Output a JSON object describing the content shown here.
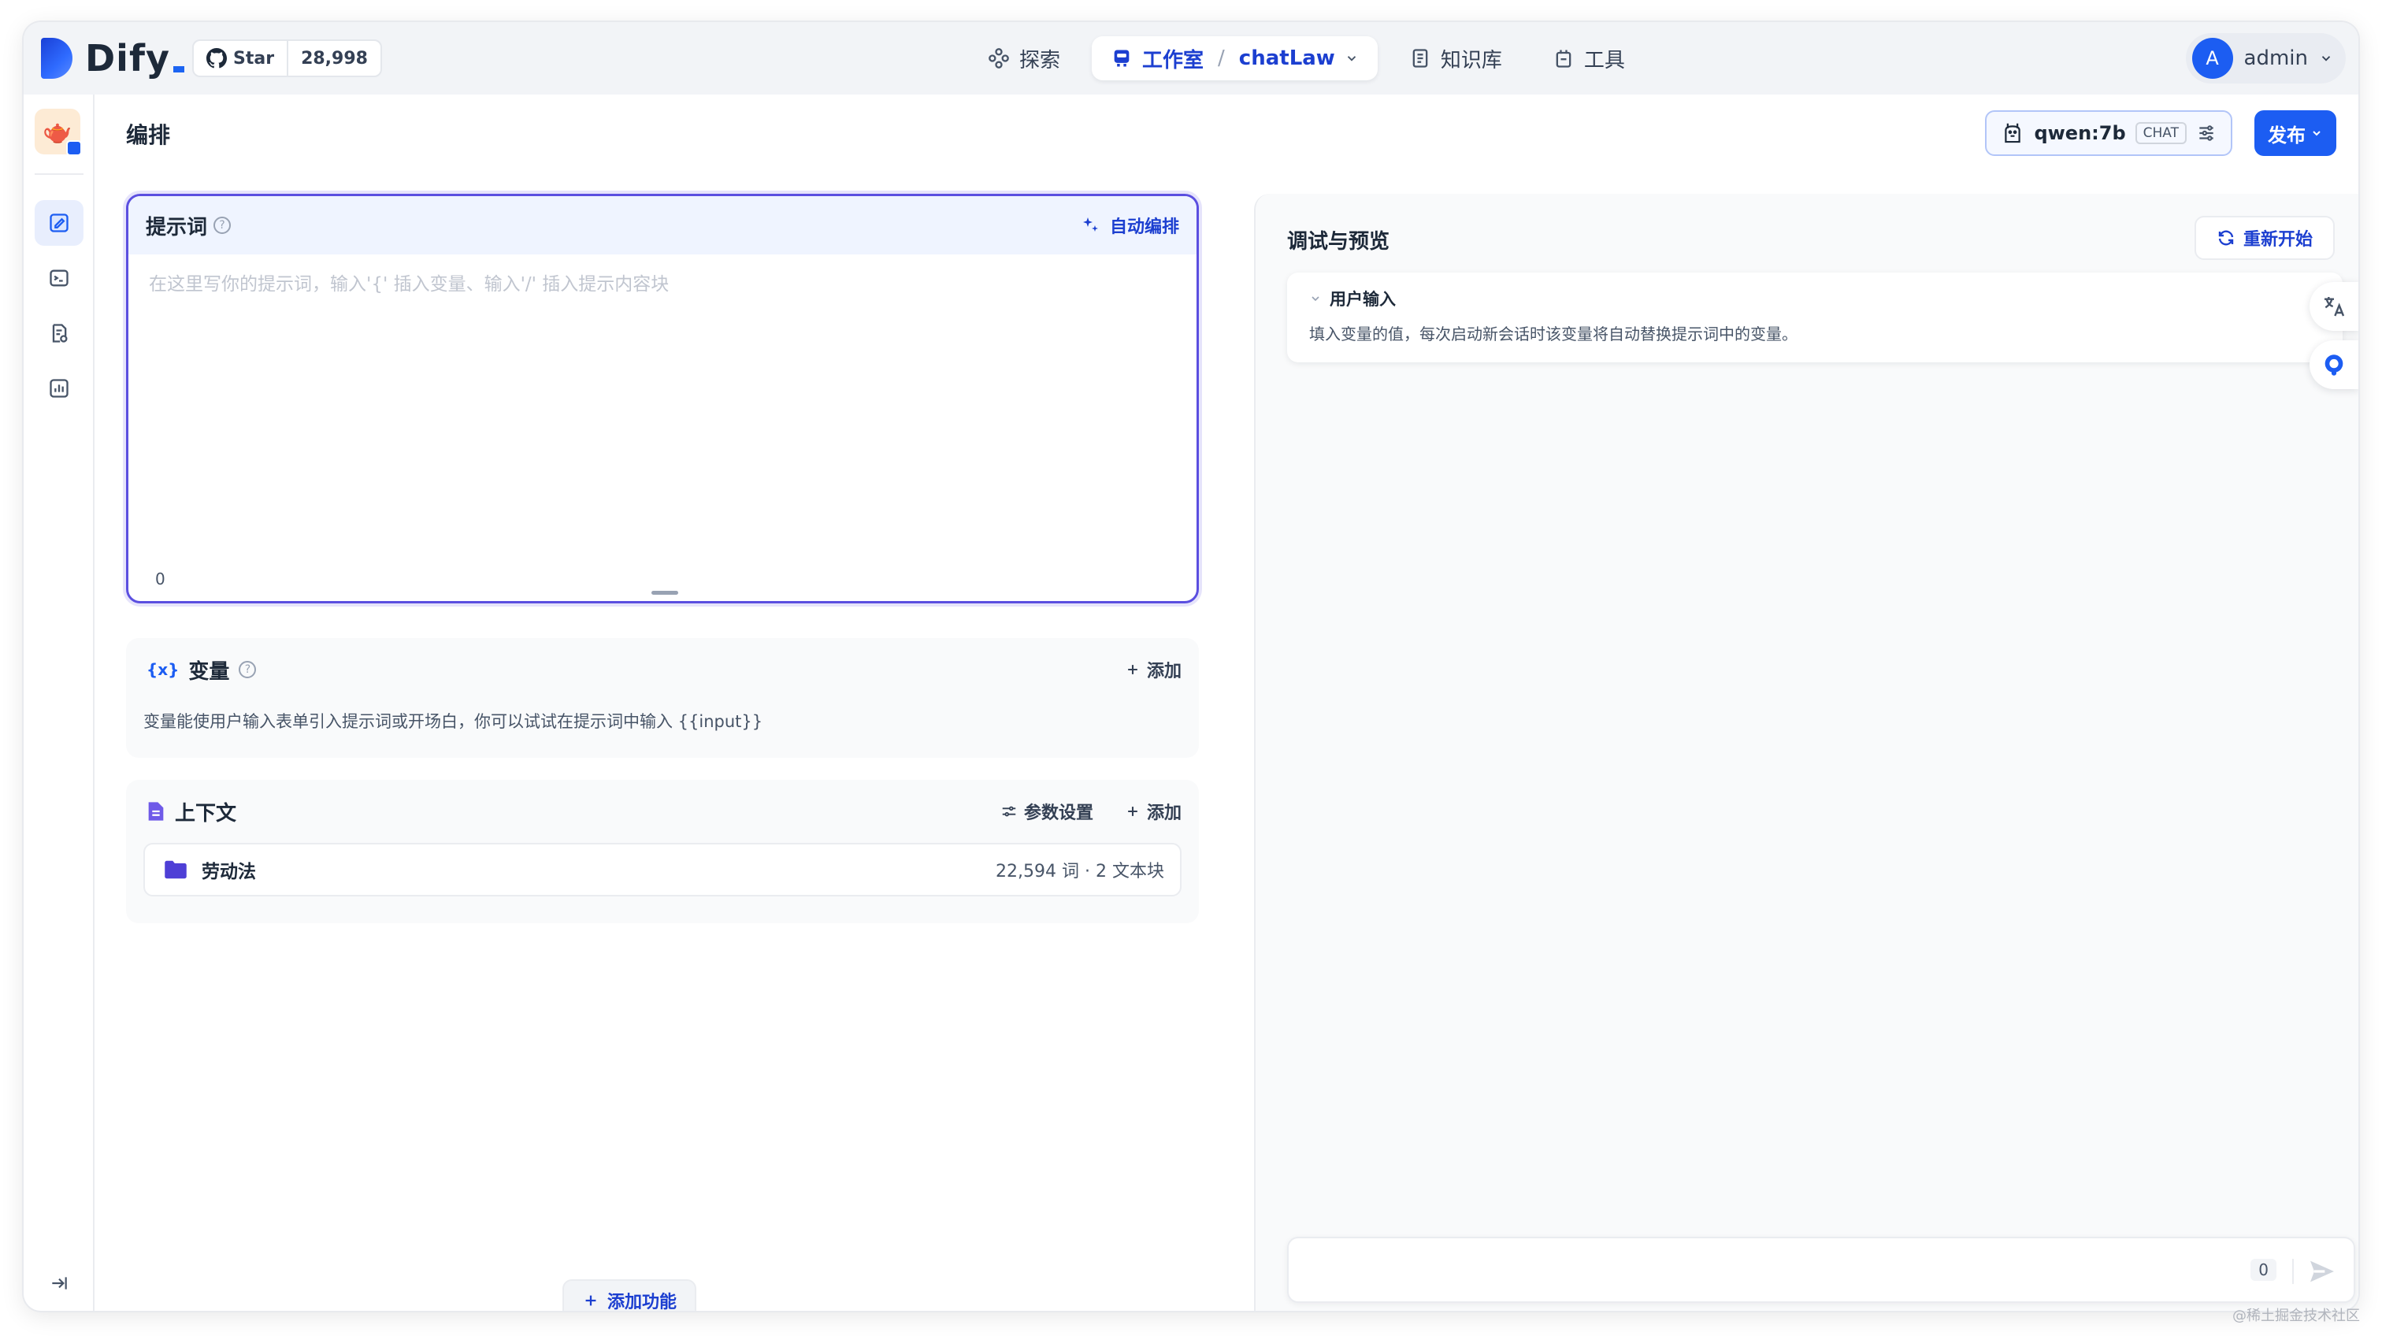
{
  "brand": {
    "name": "Dify",
    "accent": "#1c5df2"
  },
  "github": {
    "star_label": "Star",
    "star_count": "28,998"
  },
  "nav": {
    "explore": "探索",
    "studio": "工作室",
    "separator": "/",
    "current_app": "chatLaw",
    "knowledge": "知识库",
    "tools": "工具"
  },
  "user": {
    "avatar_initial": "A",
    "name": "admin"
  },
  "page": {
    "title": "编排"
  },
  "model": {
    "name": "qwen:7b",
    "mode_tag": "CHAT"
  },
  "publish": {
    "label": "发布"
  },
  "prompt": {
    "title": "提示词",
    "auto_label": "自动编排",
    "placeholder": "在这里写你的提示词，输入'{' 插入变量、输入'/' 插入提示内容块",
    "count": "0"
  },
  "variables": {
    "icon": "{x}",
    "title": "变量",
    "add_label": "添加",
    "description": "变量能使用户输入表单引入提示词或开场白，你可以试试在提示词中输入 {{input}}"
  },
  "context": {
    "title": "上下文",
    "params_label": "参数设置",
    "add_label": "添加",
    "datasets": [
      {
        "name": "劳动法",
        "meta": "22,594 词 · 2 文本块"
      }
    ]
  },
  "add_feature": {
    "label": "添加功能"
  },
  "debug": {
    "title": "调试与预览",
    "restart_label": "重新开始",
    "user_input_title": "用户输入",
    "user_input_desc": "填入变量的值，每次启动新会话时该变量将自动替换提示词中的变量。",
    "chat_count": "0"
  },
  "watermark": "@稀土掘金技术社区"
}
